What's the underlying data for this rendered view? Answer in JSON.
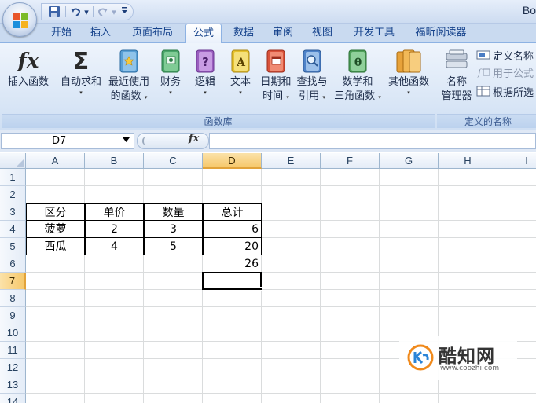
{
  "titlebar": {
    "app_title": "Bo",
    "qat": {
      "save_icon": "save-icon",
      "undo_icon": "undo-icon",
      "redo_icon": "redo-icon",
      "customize_icon": "customize-qat-icon"
    }
  },
  "tabs": [
    {
      "label": "开始"
    },
    {
      "label": "插入"
    },
    {
      "label": "页面布局"
    },
    {
      "label": "公式",
      "active": true
    },
    {
      "label": "数据"
    },
    {
      "label": "审阅"
    },
    {
      "label": "视图"
    },
    {
      "label": "开发工具"
    },
    {
      "label": "福昕阅读器"
    }
  ],
  "ribbon": {
    "function_library": {
      "label": "函数库",
      "insert_function": {
        "icon": "fx",
        "label": "插入函数"
      },
      "buttons": [
        {
          "label_line1": "自动求和",
          "icon": "sigma-icon"
        },
        {
          "label_line1": "最近使用",
          "label_line2": "的函数",
          "icon": "recent-functions-book-icon"
        },
        {
          "label_line1": "财务",
          "icon": "financial-book-icon"
        },
        {
          "label_line1": "逻辑",
          "icon": "logical-book-icon"
        },
        {
          "label_line1": "文本",
          "icon": "text-book-icon"
        },
        {
          "label_line1": "日期和",
          "label_line2": "时间",
          "icon": "date-time-book-icon"
        },
        {
          "label_line1": "查找与",
          "label_line2": "引用",
          "icon": "lookup-reference-book-icon"
        },
        {
          "label_line1": "数学和",
          "label_line2": "三角函数",
          "icon": "math-trig-book-icon"
        },
        {
          "label_line1": "其他函数",
          "icon": "more-functions-book-icon"
        }
      ]
    },
    "defined_names": {
      "label": "定义的名称",
      "name_manager": {
        "label_line1": "名称",
        "label_line2": "管理器"
      },
      "define_name": "定义名称",
      "use_in_formula": "用于公式",
      "create_from_selection": "根据所选"
    },
    "glyphs": {
      "fx": "fx",
      "sigma": "Σ",
      "question": "?",
      "text_a": "A",
      "theta": "θ",
      "dropdown": "▾"
    }
  },
  "formula_bar": {
    "name_box": "D7",
    "fx_label": "fx",
    "formula": ""
  },
  "sheet": {
    "columns": [
      "A",
      "B",
      "C",
      "D",
      "E",
      "F",
      "G",
      "H",
      "I"
    ],
    "rows": [
      "1",
      "2",
      "3",
      "4",
      "5",
      "6",
      "7",
      "8",
      "9",
      "10",
      "11",
      "12",
      "13",
      "14"
    ],
    "selected_cell": "D7",
    "table_headers": [
      "区分",
      "单价",
      "数量",
      "总计"
    ],
    "table_rows": [
      [
        "菠萝",
        "2",
        "3",
        "6"
      ],
      [
        "西瓜",
        "4",
        "5",
        "20"
      ]
    ],
    "sum_value": "26"
  },
  "watermark": {
    "name": "酷知网",
    "url": "www.coozhi.com"
  }
}
